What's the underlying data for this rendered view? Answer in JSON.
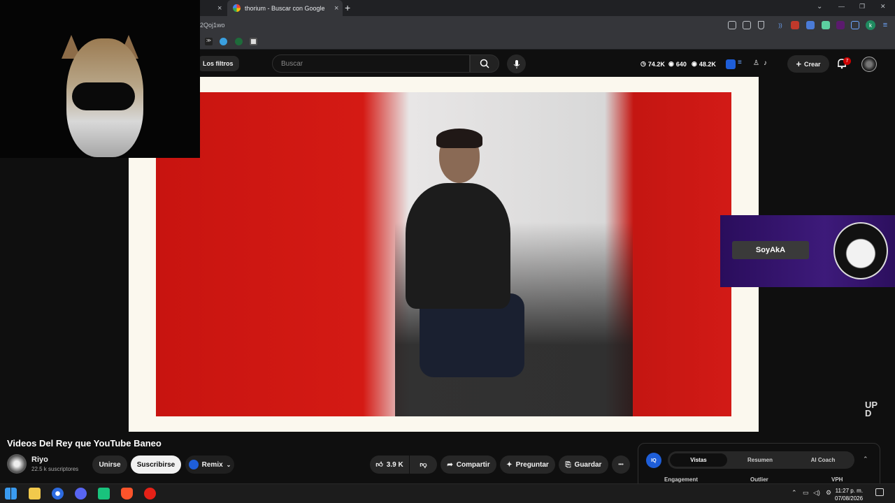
{
  "browser": {
    "tabs": [
      {
        "title": "",
        "close": "×"
      },
      {
        "title": "thorium - Buscar con Google",
        "close": "×"
      }
    ],
    "new_tab": "+",
    "url_fragment": "2Qoj1wo",
    "window_controls": {
      "minimize": "—",
      "maximize": "❐",
      "close": "✕",
      "dropdown": "⌄"
    },
    "extension_avatar": "k"
  },
  "youtube_header": {
    "filters_label": "Los filtros",
    "search_placeholder": "Buscar",
    "stats": {
      "subs": "74.2K",
      "live": "640",
      "views": "48.2K"
    },
    "create_label": "Crear",
    "notification_count": "7"
  },
  "overlay": {
    "badge_name": "SoyAkA",
    "logo_text": "UP D"
  },
  "video": {
    "title": "Videos Del Rey que YouTube Baneo",
    "channel_name": "Riyo",
    "channel_subs": "22.5 k suscriptores",
    "join_label": "Unirse",
    "subscribe_label": "Suscribirse",
    "remix_label": "Remix",
    "likes": "3.9 K",
    "share_label": "Compartir",
    "ask_label": "Preguntar",
    "save_label": "Guardar",
    "more_label": "•••"
  },
  "side_panel": {
    "iq_label": "IQ",
    "tabs": [
      "Vistas",
      "Resumen",
      "AI Coach"
    ],
    "columns": [
      "Engagement",
      "Outlier",
      "VPH"
    ]
  },
  "taskbar": {
    "time": "11:27 p. m.",
    "date": "07/08/2026"
  },
  "colors": {
    "youtube_bg": "#0f0f0f",
    "chrome_bg": "#35363a",
    "brand_red": "#cc0000",
    "iq_blue": "#1e5ed9",
    "badge_purple": "#3d1a7a"
  }
}
